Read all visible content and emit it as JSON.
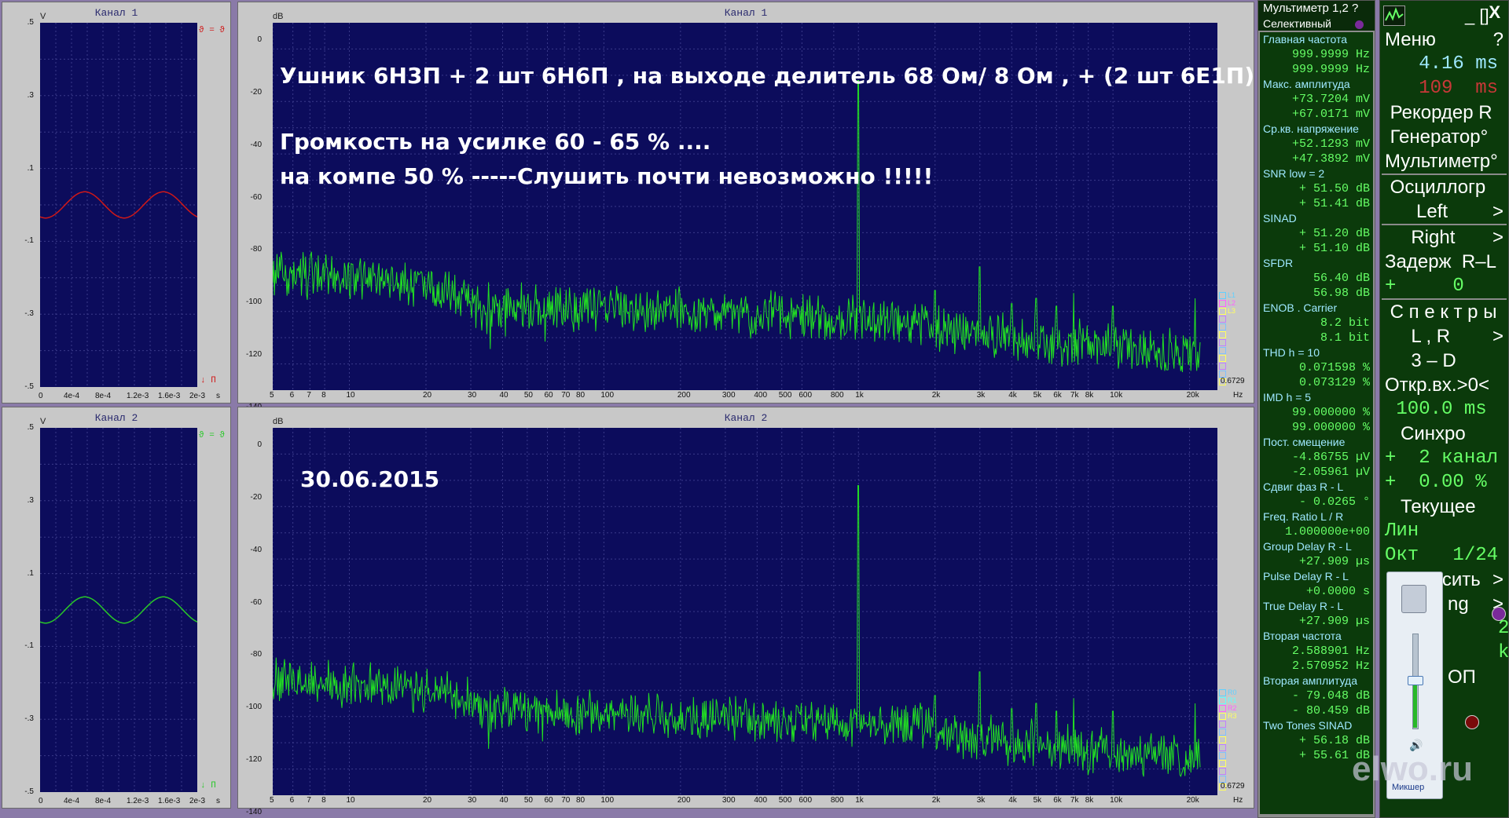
{
  "windows": {
    "osc1": {
      "title": "Канал 1",
      "unit": "V",
      "y_ticks": [
        ".5",
        ".3",
        ".1",
        "-.1",
        "-.3",
        "-.5"
      ],
      "x_ticks": [
        "0",
        "4e-4",
        "8e-4",
        "1.2e-3",
        "1.6e-3",
        "2e-3"
      ],
      "x_unit": "s",
      "corner_top": "ϑ = ϑ",
      "corner_bottom": "↓ Π",
      "wave_color": "#d01818"
    },
    "osc2": {
      "title": "Канал 2",
      "unit": "V",
      "y_ticks": [
        ".5",
        ".3",
        ".1",
        "-.1",
        "-.3",
        "-.5"
      ],
      "x_ticks": [
        "0",
        "4e-4",
        "8e-4",
        "1.2e-3",
        "1.6e-3",
        "2e-3"
      ],
      "x_unit": "s",
      "corner_top": "ϑ = ϑ",
      "corner_bottom": "↓ Π",
      "wave_color": "#28c828"
    },
    "spec1": {
      "title": "Канал 1",
      "unit": "dB",
      "x_unit": "Hz",
      "corner_value": "0.6729",
      "legend": [
        "L1",
        "L2",
        "L3"
      ]
    },
    "spec2": {
      "title": "Канал 2",
      "unit": "dB",
      "x_unit": "Hz",
      "corner_value": "0.6729",
      "legend": [
        "R0",
        "R1",
        "R2",
        "R3"
      ]
    }
  },
  "spectrum_axis": {
    "y_ticks": [
      "0",
      "-20",
      "-40",
      "-60",
      "-80",
      "-100",
      "-120",
      "-140"
    ],
    "x_ticks": [
      "5",
      "6",
      "7",
      "8",
      "10",
      "20",
      "30",
      "40",
      "50",
      "60",
      "70",
      "80",
      "100",
      "200",
      "300",
      "400",
      "500",
      "600",
      "800",
      "1k",
      "2k",
      "3k",
      "4k",
      "5k",
      "6k",
      "7k",
      "8k",
      "10k",
      "20k"
    ]
  },
  "notes": {
    "line1": "Ушник  6Н3П + 2 шт 6Н6П , на выходе делитель 68 Ом/ 8 Ом , + (2 шт 6Е1П)",
    "line2": "Громкость на усилке 60 - 65 % ....",
    "line3": "на компе 50 %     -----Слушить почти невозможно !!!!!",
    "date": "30.06.2015"
  },
  "multimeter": {
    "title": "Мультиметр 1,2 ?",
    "mode": "Селективный",
    "rows": [
      {
        "type": "lbl",
        "text": "Главная частота"
      },
      {
        "type": "val",
        "text": "999.9999  Hz"
      },
      {
        "type": "val",
        "text": "999.9999  Hz"
      },
      {
        "type": "lbl",
        "text": "Макс. амплитуда"
      },
      {
        "type": "val",
        "text": "+73.7204 mV"
      },
      {
        "type": "val",
        "text": "+67.0171 mV"
      },
      {
        "type": "lbl",
        "text": "Ср.кв. напряжение"
      },
      {
        "type": "val",
        "text": "+52.1293 mV"
      },
      {
        "type": "val",
        "text": "+47.3892 mV"
      },
      {
        "type": "lbl",
        "text": "SNR     low =   2"
      },
      {
        "type": "val",
        "text": "+ 51.50 dB"
      },
      {
        "type": "val",
        "text": "+ 51.41 dB"
      },
      {
        "type": "lbl",
        "text": "SINAD"
      },
      {
        "type": "val",
        "text": "+ 51.20 dB"
      },
      {
        "type": "val",
        "text": "+ 51.10 dB"
      },
      {
        "type": "lbl",
        "text": "SFDR"
      },
      {
        "type": "val",
        "text": "56.40 dB"
      },
      {
        "type": "val",
        "text": "56.98 dB"
      },
      {
        "type": "lbl",
        "text": "ENOB . Carrier"
      },
      {
        "type": "val",
        "text": "8.2 bit"
      },
      {
        "type": "val",
        "text": "8.1 bit"
      },
      {
        "type": "lbl",
        "text": "THD       h =   10"
      },
      {
        "type": "val",
        "text": "0.071598 %"
      },
      {
        "type": "val",
        "text": "0.073129 %"
      },
      {
        "type": "lbl",
        "text": "IMD        h =   5"
      },
      {
        "type": "val",
        "text": "99.000000 %"
      },
      {
        "type": "val",
        "text": "99.000000 %"
      },
      {
        "type": "lbl",
        "text": "Пост. смещение"
      },
      {
        "type": "val",
        "text": "-4.86755 µV"
      },
      {
        "type": "val",
        "text": "-2.05961 µV"
      },
      {
        "type": "lbl",
        "text": "Сдвиг фаз R - L"
      },
      {
        "type": "val",
        "text": "-   0.0265 °"
      },
      {
        "type": "lbl",
        "text": "Freq. Ratio  L / R"
      },
      {
        "type": "val",
        "text": "1.000000e+00"
      },
      {
        "type": "lbl",
        "text": "Group Delay R - L"
      },
      {
        "type": "val",
        "text": "+27.909 µs"
      },
      {
        "type": "lbl",
        "text": "Pulse Delay R - L"
      },
      {
        "type": "val",
        "text": "+0.0000  s"
      },
      {
        "type": "lbl",
        "text": "True Delay R - L"
      },
      {
        "type": "val",
        "text": "+27.909 µs"
      },
      {
        "type": "lbl",
        "text": "Вторая частота"
      },
      {
        "type": "val",
        "text": "2.588901  Hz"
      },
      {
        "type": "val",
        "text": "2.570952  Hz"
      },
      {
        "type": "lbl",
        "text": "Вторая амплитуда"
      },
      {
        "type": "val",
        "text": "-  79.048 dB"
      },
      {
        "type": "val",
        "text": "-  80.459 dB"
      },
      {
        "type": "lbl",
        "text": "Two Tones SINAD"
      },
      {
        "type": "val",
        "text": "+ 56.18 dB"
      },
      {
        "type": "val",
        "text": "+ 55.61 dB"
      }
    ]
  },
  "menu": {
    "close": "X",
    "minmax": "_ []",
    "items": [
      {
        "cls": "it",
        "text": "Меню",
        "arrow": "?"
      },
      {
        "cls": "grn",
        "text": "   4.16 ms",
        "color": "#9ee8ff"
      },
      {
        "cls": "grn",
        "text": "   109  ms",
        "color": "#c83838"
      },
      {
        "cls": "it",
        "text": " Рекордер R"
      },
      {
        "cls": "it",
        "text": " Генератор°"
      },
      {
        "cls": "it",
        "text": "Мультиметр°"
      },
      {
        "cls": "sep"
      },
      {
        "cls": "it",
        "text": " Осциллогр"
      },
      {
        "cls": "it",
        "text": "      Left",
        "arrow": ">"
      },
      {
        "cls": "sep"
      },
      {
        "cls": "it",
        "text": "     Right",
        "arrow": ">"
      },
      {
        "cls": "it",
        "text": "Задерж  R–L"
      },
      {
        "cls": "grn",
        "text": "+     0"
      },
      {
        "cls": "sep"
      },
      {
        "cls": "it",
        "text": " С п е к т р ы"
      },
      {
        "cls": "it",
        "text": "     L , R",
        "arrow": ">"
      },
      {
        "cls": "it",
        "text": "     3 – D"
      },
      {
        "cls": "it",
        "text": "Откр.вх.>0<"
      },
      {
        "cls": "grn",
        "text": " 100.0 ms"
      },
      {
        "cls": "it",
        "text": "   Синхро"
      },
      {
        "cls": "grn",
        "text": "+  2 канал"
      },
      {
        "cls": "grn",
        "text": "+  0.00 %"
      },
      {
        "cls": "it",
        "text": "   Текущее"
      },
      {
        "cls": "grn",
        "text": "Лин        1"
      },
      {
        "cls": "grn",
        "text": "Окт   1/24"
      },
      {
        "cls": "it",
        "text": "   Взвесить",
        "arrow": ">"
      },
      {
        "cls": "it",
        "text": "            ng",
        "arrow": ">"
      },
      {
        "cls": "grn",
        "text": ""
      },
      {
        "cls": "grn",
        "text": "          2 16"
      },
      {
        "cls": "grn",
        "text": "          kHz"
      },
      {
        "cls": "it",
        "text": "            ОП"
      }
    ]
  },
  "mixer": {
    "label": "Микшер"
  },
  "watermark": "elwo.ru"
}
